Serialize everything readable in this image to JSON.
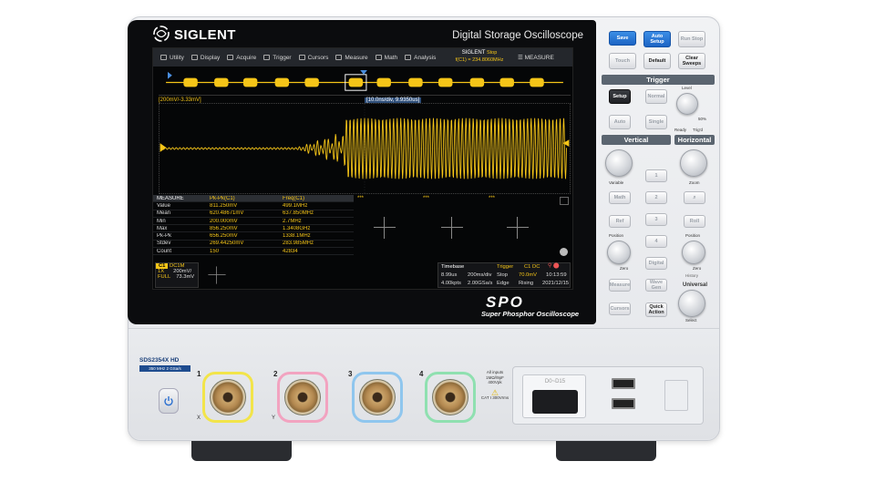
{
  "device": {
    "brand": "SIGLENT",
    "title": "Digital Storage Oscilloscope",
    "logo": "SPO",
    "logo_sub": "Super Phosphor Oscilloscope",
    "model": "SDS2354X HD",
    "model_sub": "350 MHz  2 GSa/s",
    "inputs_note": [
      "All inputs",
      "1MΩ//9pF",
      "400Vpk"
    ],
    "cat_note": "CAT I 300Vrms",
    "ddis_label": "D0~D15"
  },
  "menubar": {
    "items": [
      {
        "label": "Utility",
        "icon": "wrench-icon"
      },
      {
        "label": "Display",
        "icon": "monitor-icon"
      },
      {
        "label": "Acquire",
        "icon": "acquire-icon"
      },
      {
        "label": "Trigger",
        "icon": "trigger-icon"
      },
      {
        "label": "Cursors",
        "icon": "cursor-icon"
      },
      {
        "label": "Measure",
        "icon": "measure-icon"
      },
      {
        "label": "Math",
        "icon": "math-icon"
      },
      {
        "label": "Analysis",
        "icon": "analysis-icon"
      }
    ],
    "trigger_badge": {
      "brand": "SIGLENT",
      "state": "Stop",
      "freq": "f(C1) = 234.8060MHz"
    },
    "measure_menu": "MEASURE"
  },
  "scales": {
    "left": "[200mV/-3.33mV]",
    "middle": "[10.0ns/div, 9.9350us]"
  },
  "measure": {
    "headers": [
      "MEASURE",
      "Pk-Pk(C1)",
      "Freq(C1)"
    ],
    "rows": [
      [
        "Value",
        "811.250mV",
        "499.1MHz"
      ],
      [
        "Mean",
        "620.48671mV",
        "637.850MHz"
      ],
      [
        "Min",
        "200.000mV",
        "2.7MHz"
      ],
      [
        "Max",
        "856.250mV",
        "1.3408GHz"
      ],
      [
        "Pk-Pk",
        "656.250mV",
        "1338.1MHz"
      ],
      [
        "Stdev",
        "269.44250mV",
        "283.985MHz"
      ],
      [
        "Count",
        "150",
        "42834"
      ]
    ],
    "extra_headers": [
      "***",
      "***",
      "***"
    ]
  },
  "channel": {
    "tag": "C1",
    "coupling": "DC1M",
    "row1": [
      "1X",
      "200mV/"
    ],
    "row2": [
      "FULL",
      "73.3mV"
    ]
  },
  "timebase": {
    "label": "Timebase",
    "delay": "8.99us",
    "per_div": "200ms/div",
    "points": "4.00kpts",
    "rate": "2.00GSa/s",
    "trigger_label": "Trigger",
    "trig_src": "C1 DC",
    "mode": "Stop",
    "level": "70.0mV",
    "type": "Edge",
    "slope": "Rising",
    "time": "10:13:59",
    "date": "2021/12/15"
  },
  "buttons": {
    "save": "Save",
    "auto_setup": "Auto Setup",
    "run_stop": "Run Stop",
    "touch": "Touch",
    "default": "Default",
    "clear_sweeps": "Clear Sweeps",
    "trigger_hdr": "Trigger",
    "setup": "Setup",
    "normal": "Normal",
    "auto": "Auto",
    "single": "Single",
    "level": "Level",
    "fifty": "50%",
    "ready": "Ready",
    "trigd": "Trig'd",
    "vertical_hdr": "Vertical",
    "horizontal_hdr": "Horizontal",
    "variable": "Variable",
    "math": "Math",
    "ref": "Ref",
    "position": "Position",
    "zero": "Zero",
    "digital": "Digital",
    "ch1": "1",
    "ch2": "2",
    "ch3": "3",
    "ch4": "4",
    "zoom": "Zoom",
    "roll": "Roll",
    "measure": "Measure",
    "cursors": "Cursors",
    "history": "History",
    "wave_gen": "Wave Gen",
    "quick_action": "Quick Action",
    "universal": "Universal",
    "select": "Select"
  },
  "channels": [
    {
      "num": "1",
      "sub": "X",
      "color": "#f2e44a"
    },
    {
      "num": "2",
      "sub": "Y",
      "color": "#f2a3c0"
    },
    {
      "num": "3",
      "sub": "",
      "color": "#8fc6ee"
    },
    {
      "num": "4",
      "sub": "",
      "color": "#8fe0b0"
    }
  ],
  "colors": {
    "trace": "#f5c518",
    "accent_blue": "#1c64c4"
  }
}
